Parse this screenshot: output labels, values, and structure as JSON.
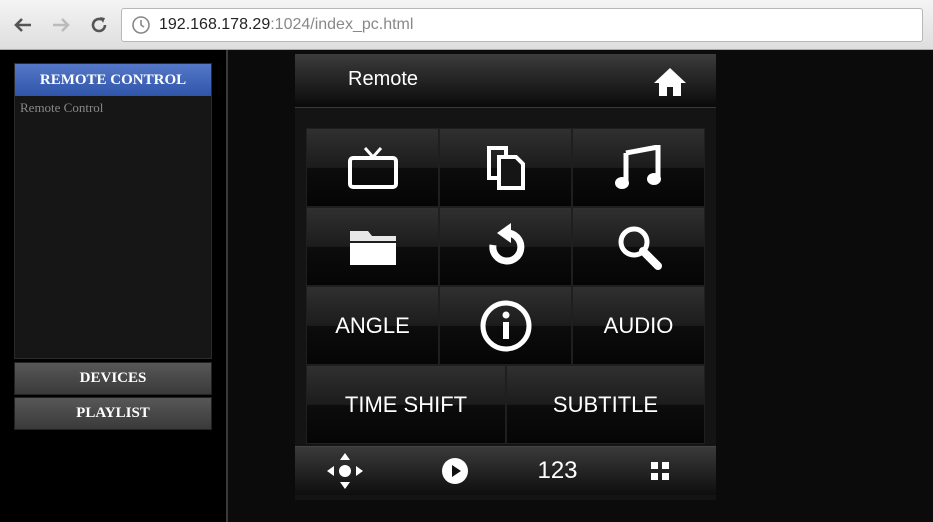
{
  "browser": {
    "back_icon": "arrow-left-icon",
    "forward_icon": "arrow-right-icon",
    "reload_icon": "reload-icon",
    "page_icon": "page-icon",
    "url_host": "192.168.178.29",
    "url_path": ":1024/index_pc.html"
  },
  "sidebar": {
    "header": "REMOTE CONTROL",
    "items": [
      {
        "label": "Remote Control"
      }
    ],
    "accordion": [
      {
        "label": "DEVICES"
      },
      {
        "label": "PLAYLIST"
      }
    ],
    "header_color": "#3f66b8"
  },
  "remote": {
    "title": "Remote",
    "home_icon": "home-icon",
    "buttons": {
      "tv_icon": "tv-icon",
      "copy_icon": "copy-icon",
      "music_icon": "music-note-icon",
      "folder_icon": "folder-icon",
      "return_icon": "return-icon",
      "search_icon": "search-icon",
      "angle": "ANGLE",
      "info_icon": "info-icon",
      "audio": "AUDIO",
      "time_shift": "TIME SHIFT",
      "subtitle": "SUBTITLE"
    },
    "toolbar": {
      "navigate_icon": "navigate-icon",
      "play_icon": "play-icon",
      "numpad": "123",
      "grid_icon": "grid-icon"
    }
  }
}
